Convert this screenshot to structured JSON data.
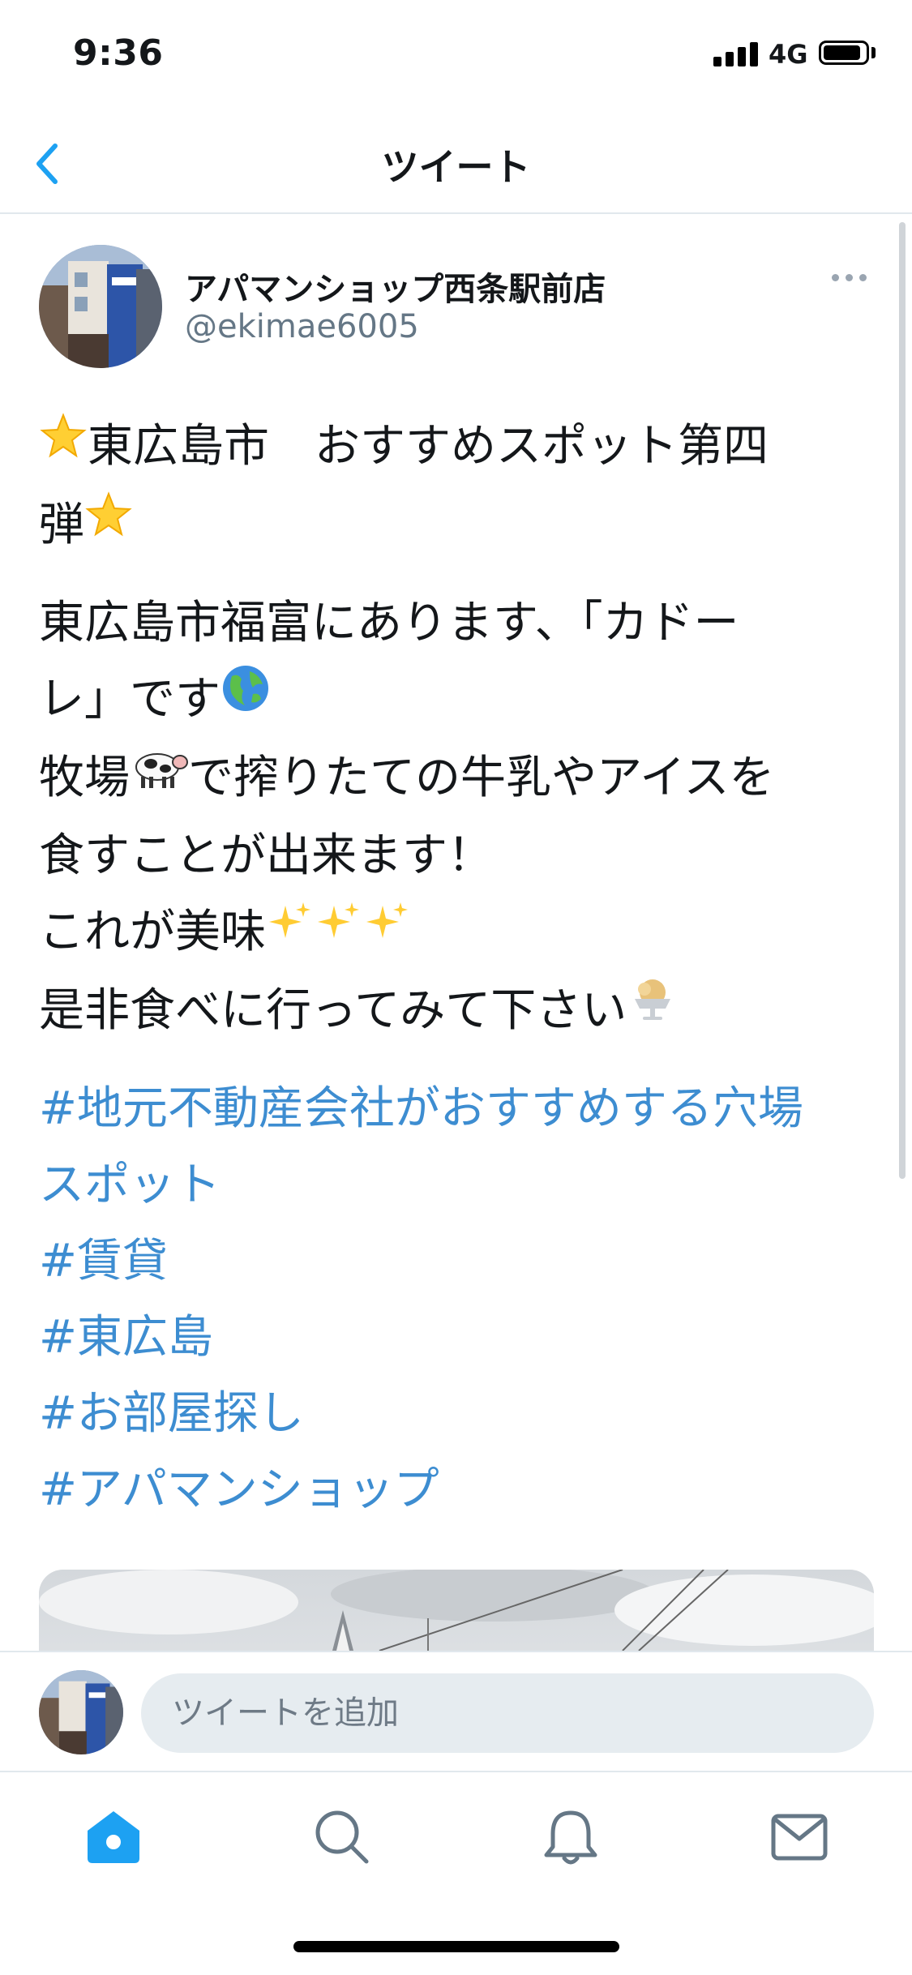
{
  "status_bar": {
    "time": "9:36",
    "network": "4G"
  },
  "header": {
    "title": "ツイート"
  },
  "tweet": {
    "author_name": "アパマンショップ西条駅前店",
    "author_handle": "@ekimae6005",
    "text_lines": [
      [
        "東広島市　おすすめスポット第四",
        "弾"
      ],
      [
        "東広島市福富にあります、「カドー",
        "レ」です"
      ],
      [
        "牧場",
        "で搾りたての牛乳やアイスを"
      ],
      [
        "食すことが出来ます！"
      ],
      [
        "これが美味"
      ],
      [
        "是非食べに行ってみて下さい"
      ]
    ],
    "hashtags": [
      "#地元不動産会社がおすすめする穴場",
      "スポット",
      "#賃貸",
      "#東広島",
      "#お部屋探し",
      "#アパマンショップ"
    ]
  },
  "reply": {
    "placeholder": "ツイートを追加"
  },
  "colors": {
    "link": "#3d8dd1",
    "accent": "#1da1f2",
    "secondary_text": "#657786"
  },
  "icons": [
    "back-chevron-icon",
    "more-icon",
    "home-icon",
    "search-icon",
    "bell-icon",
    "mail-icon"
  ]
}
